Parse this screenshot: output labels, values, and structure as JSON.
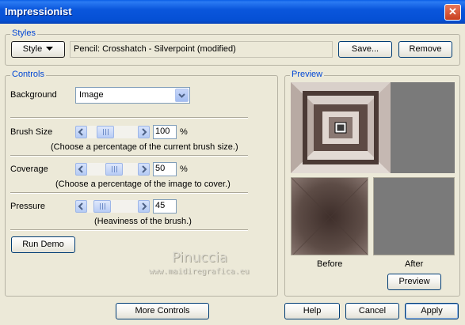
{
  "window": {
    "title": "Impressionist",
    "close_symbol": "✕"
  },
  "styles": {
    "group_title": "Styles",
    "style_button": "Style",
    "preset_name": "Pencil: Crosshatch - Silverpoint (modified)",
    "save_button": "Save...",
    "remove_button": "Remove"
  },
  "controls": {
    "group_title": "Controls",
    "background_label": "Background",
    "background_value": "Image",
    "brush_size": {
      "label": "Brush Size",
      "value": "100",
      "unit": "%",
      "hint": "(Choose a percentage of the current brush size.)"
    },
    "coverage": {
      "label": "Coverage",
      "value": "50",
      "unit": "%",
      "hint": "(Choose a percentage of the image to cover.)"
    },
    "pressure": {
      "label": "Pressure",
      "value": "45",
      "hint": "(Heaviness of the brush.)"
    },
    "run_demo_button": "Run Demo"
  },
  "preview": {
    "group_title": "Preview",
    "before_label": "Before",
    "after_label": "After",
    "preview_button": "Preview"
  },
  "watermark": {
    "name": "Pinuccia",
    "site": "www.maidiregrafica.eu"
  },
  "footer": {
    "more_controls_button": "More Controls",
    "help_button": "Help",
    "cancel_button": "Cancel",
    "apply_button": "Apply"
  },
  "colors": {
    "title_bar": "#0a56dc",
    "group_title": "#0046d5",
    "dialog_bg": "#ece9d8",
    "preview_gray": "#7a7a7a",
    "preview_brown": "#5a4a44"
  }
}
